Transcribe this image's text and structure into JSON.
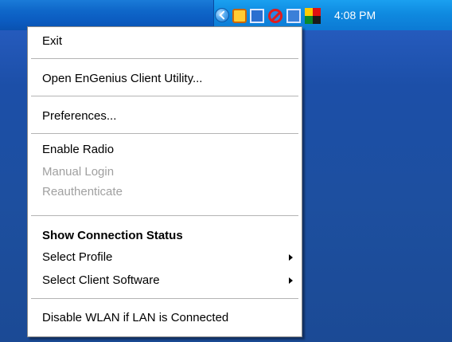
{
  "tray": {
    "clock": "4:08 PM",
    "icons": [
      "show-hidden-icons-chevron",
      "clock-icon",
      "network-icon",
      "wireless-disabled-icon",
      "computers-icon",
      "engenius-icon"
    ]
  },
  "menu": {
    "items": [
      {
        "label": "Exit",
        "enabled": true,
        "bold": false,
        "submenu": false
      },
      {
        "label": "Open EnGenius Client Utility...",
        "enabled": true,
        "bold": false,
        "submenu": false
      },
      {
        "label": "Preferences...",
        "enabled": true,
        "bold": false,
        "submenu": false
      },
      {
        "label": "Enable Radio",
        "enabled": true,
        "bold": false,
        "submenu": false
      },
      {
        "label": "Manual Login",
        "enabled": false,
        "bold": false,
        "submenu": false
      },
      {
        "label": "Reauthenticate",
        "enabled": false,
        "bold": false,
        "submenu": false
      },
      {
        "label": "Show Connection Status",
        "enabled": true,
        "bold": true,
        "submenu": false
      },
      {
        "label": "Select Profile",
        "enabled": true,
        "bold": false,
        "submenu": true
      },
      {
        "label": "Select Client Software",
        "enabled": true,
        "bold": false,
        "submenu": true
      },
      {
        "label": "Disable WLAN if LAN is Connected",
        "enabled": true,
        "bold": false,
        "submenu": false
      }
    ]
  },
  "colors": {
    "menu_background": "#ffffff",
    "disabled_text": "#a0a0a0",
    "desktop": "#1d4f9f",
    "taskbar": "#0c7ad4"
  }
}
